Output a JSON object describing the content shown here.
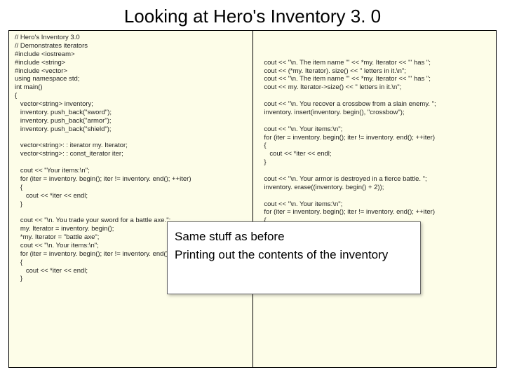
{
  "slide": {
    "title": "Looking at Hero's Inventory 3. 0"
  },
  "code": {
    "left": "// Hero's Inventory 3.0\n// Demonstrates iterators\n#include <iostream>\n#include <string>\n#include <vector>\nusing namespace std;\nint main()\n{\n   vector<string> inventory;\n   inventory. push_back(\"sword\");\n   inventory. push_back(\"armor\");\n   inventory. push_back(\"shield\");\n\n   vector<string>: : iterator my. Iterator;\n   vector<string>: : const_iterator iter;\n\n   cout << \"Your items:\\n\";\n   for (iter = inventory. begin(); iter != inventory. end(); ++iter)\n   {\n      cout << *iter << endl;\n   }\n\n   cout << \"\\n. You trade your sword for a battle axe.\";\n   my. Iterator = inventory. begin();\n   *my. Iterator = \"battle axe\";\n   cout << \"\\n. Your items:\\n\";\n   for (iter = inventory. begin(); iter != inventory. end(); ++iter)\n   {\n      cout << *iter << endl;\n   }",
    "right": "\n\n\n   cout << \"\\n. The item name '\" << *my. Iterator << \"' has \";\n   cout << (*my. Iterator). size() << \" letters in it.\\n\";\n   cout << \"\\n. The item name '\" << *my. Iterator << \"' has \";\n   cout << my. Iterator->size() << \" letters in it.\\n\";\n\n   cout << \"\\n. You recover a crossbow from a slain enemy. \";\n   inventory. insert(inventory. begin(), \"crossbow\");\n\n   cout << \"\\n. Your items:\\n\";\n   for (iter = inventory. begin(); iter != inventory. end(); ++iter)\n   {\n      cout << *iter << endl;\n   }\n\n   cout << \"\\n. Your armor is destroyed in a fierce battle. \";\n   inventory. erase((inventory. begin() + 2));\n\n   cout << \"\\n. Your items:\\n\";\n   for (iter = inventory. begin(); iter != inventory. end(); ++iter)\n   {\n      cout << *iter << endl;\n   }\n   cout << endl;\n   return 0;\n}"
  },
  "callout": {
    "line1": "Same stuff as before",
    "line2": "Printing out the contents of the inventory"
  }
}
